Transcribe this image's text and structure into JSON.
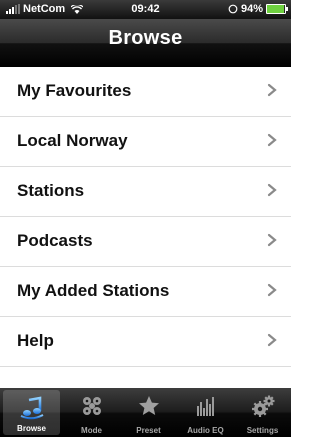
{
  "status_bar": {
    "carrier": "NetCom",
    "time": "09:42",
    "battery_text": "94%",
    "battery_level": 0.94,
    "battery_color": "#6fd040"
  },
  "header": {
    "title": "Browse"
  },
  "list": {
    "items": [
      {
        "label": "My Favourites"
      },
      {
        "label": "Local Norway"
      },
      {
        "label": "Stations"
      },
      {
        "label": "Podcasts"
      },
      {
        "label": "My Added Stations"
      },
      {
        "label": "Help"
      }
    ]
  },
  "tabs": [
    {
      "label": "Browse",
      "icon": "music-note-icon",
      "active": true
    },
    {
      "label": "Mode",
      "icon": "gear-cluster-icon",
      "active": false
    },
    {
      "label": "Preset",
      "icon": "star-icon",
      "active": false
    },
    {
      "label": "Audio EQ",
      "icon": "equalizer-icon",
      "active": false
    },
    {
      "label": "Settings",
      "icon": "settings-gears-icon",
      "active": false
    }
  ],
  "colors": {
    "accent_blue": "#2f8ff0",
    "row_divider": "#dcdcdc"
  }
}
